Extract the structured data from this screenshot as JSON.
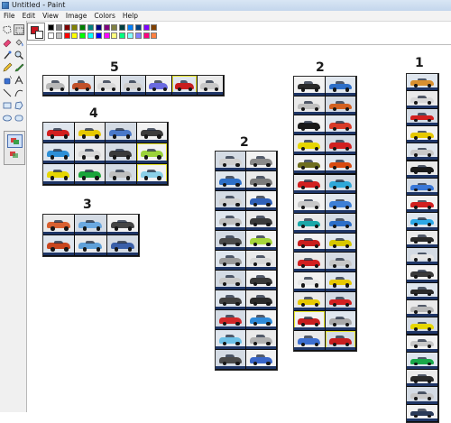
{
  "window": {
    "title": "Untitled - Paint"
  },
  "menu": [
    "File",
    "Edit",
    "View",
    "Image",
    "Colors",
    "Help"
  ],
  "tools": [
    "free-select-icon",
    "select-icon",
    "eraser-icon",
    "fill-icon",
    "color-picker-icon",
    "magnifier-icon",
    "pencil-icon",
    "brush-icon",
    "airbrush-icon",
    "text-icon",
    "line-icon",
    "curve-icon",
    "rectangle-icon",
    "polygon-icon",
    "ellipse-icon",
    "rounded-rectangle-icon"
  ],
  "colors": {
    "foreground": "#c8141e",
    "background": "#ffffff",
    "palette_top": [
      "#000000",
      "#808080",
      "#800000",
      "#808000",
      "#008000",
      "#008080",
      "#000080",
      "#800080",
      "#808040",
      "#004040",
      "#0080ff",
      "#004080",
      "#8000ff",
      "#804000"
    ],
    "palette_bottom": [
      "#ffffff",
      "#c0c0c0",
      "#ff0000",
      "#ffff00",
      "#00ff00",
      "#00ffff",
      "#0000ff",
      "#ff00ff",
      "#ffff80",
      "#00ff80",
      "#80ffff",
      "#8080ff",
      "#ff0080",
      "#ff8040"
    ]
  },
  "canvas": {
    "groups": [
      {
        "label": "5",
        "cols": 7,
        "rows": 1,
        "colors": [
          "#b9b9b9",
          "#c0502a",
          "#d9d9d9",
          "#cfcfcf",
          "#6a6ae0",
          "#c81e1e",
          "#c8c8c8"
        ],
        "highlight": [
          5
        ]
      },
      {
        "label": "4",
        "cols": 4,
        "rows": 3,
        "colors": [
          "#d22020",
          "#e6c800",
          "#4a78c8",
          "#3c3c3c",
          "#2d8fd6",
          "#d8d8d8",
          "#3a3a3a",
          "#9bd23a",
          "#e6d600",
          "#19a43a",
          "#bfbfbf",
          "#8bd0e8"
        ],
        "highlight": [
          7,
          11
        ]
      },
      {
        "label": "3",
        "cols": 3,
        "rows": 2,
        "colors": [
          "#d86030",
          "#6aa8e0",
          "#444444",
          "#c8461e",
          "#5fa0d8",
          "#3a5fa8"
        ],
        "highlight": []
      },
      {
        "label": "2",
        "cols": 2,
        "rows": 11,
        "colors": [
          "#cfcfcf",
          "#8a8a8a",
          "#2d6fc8",
          "#7a7a7a",
          "#cfcfcf",
          "#3060b8",
          "#bfbfbf",
          "#3a3a3a",
          "#4a4a4a",
          "#a6d63a",
          "#9a9a9a",
          "#d8d8d8",
          "#c8c8c8",
          "#383838",
          "#404040",
          "#2a2a2a",
          "#d22828",
          "#2f8ad8",
          "#6cc0e6",
          "#b0b0b0",
          "#4a4a4a",
          "#3a66c8",
          "#c0c0c0",
          "#d8d8d8"
        ],
        "highlight": []
      },
      {
        "label": "2",
        "cols": 2,
        "rows": 14,
        "colors": [
          "#2a2a2a",
          "#2d6fc8",
          "#bfbfbf",
          "#d26020",
          "#1a1a1a",
          "#d83a28",
          "#e6d600",
          "#d22020",
          "#6e6e1e",
          "#d84a10",
          "#d22020",
          "#2fa8d8",
          "#c8c8c8",
          "#3d7fd6",
          "#1ba8a8",
          "#2d6fc8",
          "#c81e1e",
          "#d8c800",
          "#d22020",
          "#c8c8c8",
          "#e6e6e6",
          "#e6c800",
          "#e6c800",
          "#d22020",
          "#c81e1e",
          "#a8a8a8",
          "#3d6fd0",
          "#c81e1e"
        ],
        "highlight": [
          24,
          27
        ]
      },
      {
        "label": "1",
        "cols": 1,
        "rows": 20,
        "colors": [
          "#d89030",
          "#d8d8d8",
          "#d22020",
          "#e6c800",
          "#c8c8c8",
          "#1a1a1a",
          "#3a78d8",
          "#d22020",
          "#2da8e6",
          "#2a2a2a",
          "#e6e6e6",
          "#3a3a3a",
          "#2a2a2a",
          "#b8b8b8",
          "#e6d600",
          "#c8c8c8",
          "#1aa84a",
          "#2a2a2a",
          "#c8c8c8",
          "#2a3a58"
        ],
        "highlight": []
      }
    ]
  }
}
